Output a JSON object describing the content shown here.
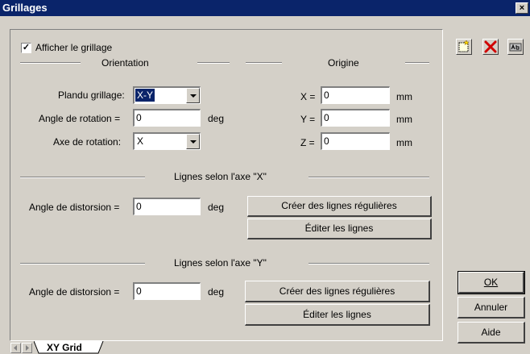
{
  "window": {
    "title": "Grillages",
    "close_label": "×"
  },
  "show_grid": {
    "label": "Afficher le grillage",
    "checked": true
  },
  "orientation": {
    "heading": "Orientation",
    "plan_label": "Plandu grillage:",
    "plan_value": "X-Y",
    "angle_label": "Angle de rotation =",
    "angle_value": "0",
    "angle_unit": "deg",
    "axis_label": "Axe de rotation:",
    "axis_value": "X"
  },
  "origin": {
    "heading": "Origine",
    "x_label": "X =",
    "x_value": "0",
    "y_label": "Y =",
    "y_value": "0",
    "z_label": "Z =",
    "z_value": "0",
    "unit": "mm"
  },
  "x_lines": {
    "heading": "Lignes selon l'axe \"X\"",
    "distortion_label": "Angle de distorsion =",
    "distortion_value": "0",
    "unit": "deg",
    "create_button": "Créer des lignes régulières",
    "edit_button": "Éditer les lignes"
  },
  "y_lines": {
    "heading": "Lignes selon l'axe \"Y\"",
    "distortion_label": "Angle de distorsion =",
    "distortion_value": "0",
    "unit": "deg",
    "create_button": "Créer des lignes régulières",
    "edit_button": "Éditer les lignes"
  },
  "toolbar": {
    "icons": [
      "new-grid-icon",
      "delete-icon",
      "rename-icon"
    ]
  },
  "actions": {
    "ok": "OK",
    "cancel": "Annuler",
    "help": "Aide"
  },
  "tabs": [
    {
      "label": "XY Grid",
      "active": true
    }
  ]
}
